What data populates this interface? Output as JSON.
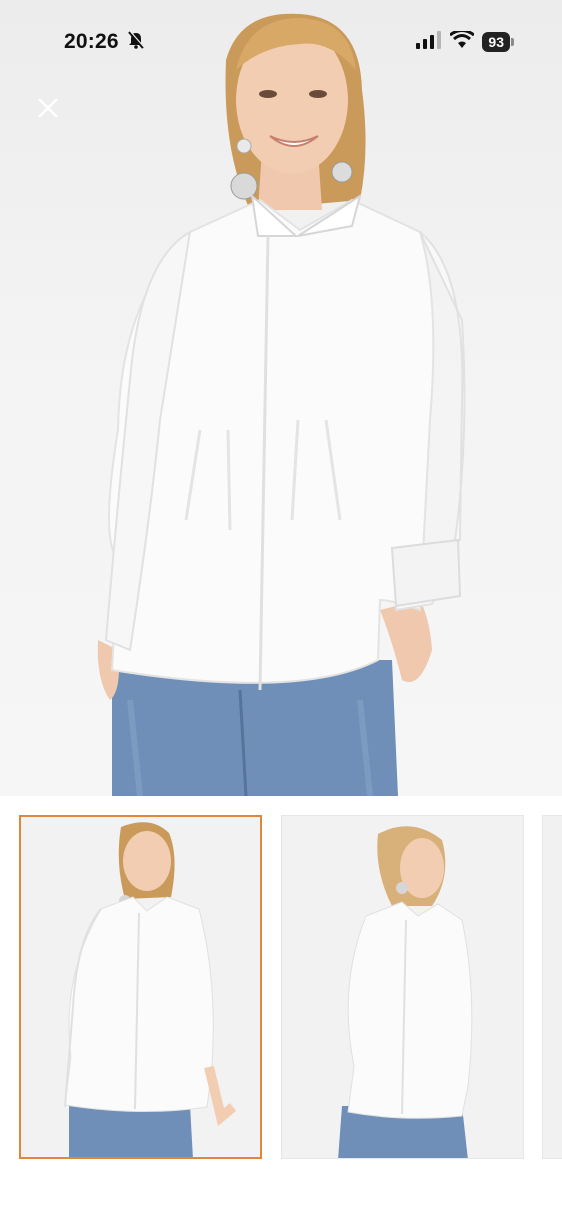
{
  "status_bar": {
    "time": "20:26",
    "battery": "93",
    "icons": [
      "bell-slash-icon",
      "signal-icon",
      "wifi-icon",
      "battery-icon"
    ]
  },
  "viewer": {
    "close_icon": "close-icon",
    "selected_index": 0,
    "accent_color": "#e2873a"
  },
  "thumbnails": [
    {
      "pose": "front",
      "selected": true
    },
    {
      "pose": "side",
      "selected": false
    },
    {
      "pose": "partial",
      "selected": false
    }
  ]
}
